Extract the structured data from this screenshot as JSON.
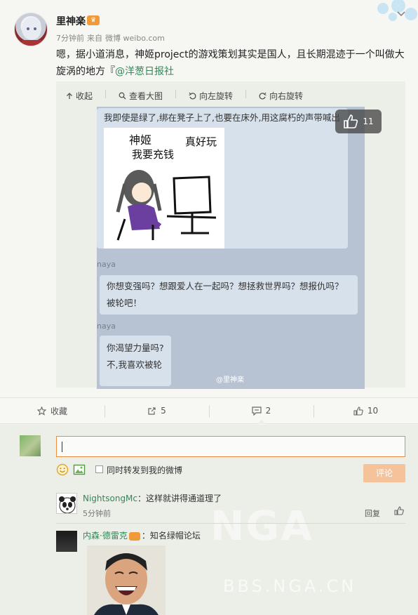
{
  "post": {
    "username": "里神楽",
    "vip_badge": "",
    "time": "7分钟前",
    "source_prefix": "来自",
    "source": "微博 weibo.com",
    "text_main": "嗯，据小道消息，神姬project的游戏策划其实是国人，且长期混迹于一个叫做大旋涡的地方『",
    "mention": "@洋葱日报社",
    "collapse_menu": "chevron-down"
  },
  "media": {
    "toolbar": {
      "collapse": "收起",
      "view_large": "查看大图",
      "rotate_left": "向左旋转",
      "rotate_right": "向右旋转"
    },
    "chat": {
      "msg1": "我即使是绿了,绑在凳子上了,也要在床外,用这腐朽的声带喊出",
      "comic_t1": "神姬",
      "comic_t2": "真好玩",
      "comic_t3": "我要充钱",
      "sender1": "naya",
      "msg2": "你想变强吗？想跟爱人在一起吗？想拯救世界吗？想报仇吗？被轮吧！",
      "sender2": "naya",
      "msg3a": "你渴望力量吗?",
      "msg3b": "不,我喜欢被轮",
      "watermark": "@里神楽"
    },
    "like_badge": "11"
  },
  "actions": {
    "favorite": "收藏",
    "repost": "5",
    "comment": "2",
    "like": "10"
  },
  "comment_box": {
    "input_value": "",
    "checkbox_label": "同时转发到我的微博",
    "submit": "评论"
  },
  "comments": [
    {
      "name": "NightsongMc",
      "text": "：这样就讲得通道理了",
      "time": "5分钟前",
      "reply": "回复"
    },
    {
      "name": "内森·德雷克",
      "text": "：知名绿帽论坛"
    }
  ],
  "watermark": {
    "big": "NGA",
    "sub": "BBS.NGA.CN"
  },
  "colors": {
    "accent_orange": "#f08a3c",
    "link_green": "#2e8a57",
    "submit_disabled": "#f5c29a"
  }
}
